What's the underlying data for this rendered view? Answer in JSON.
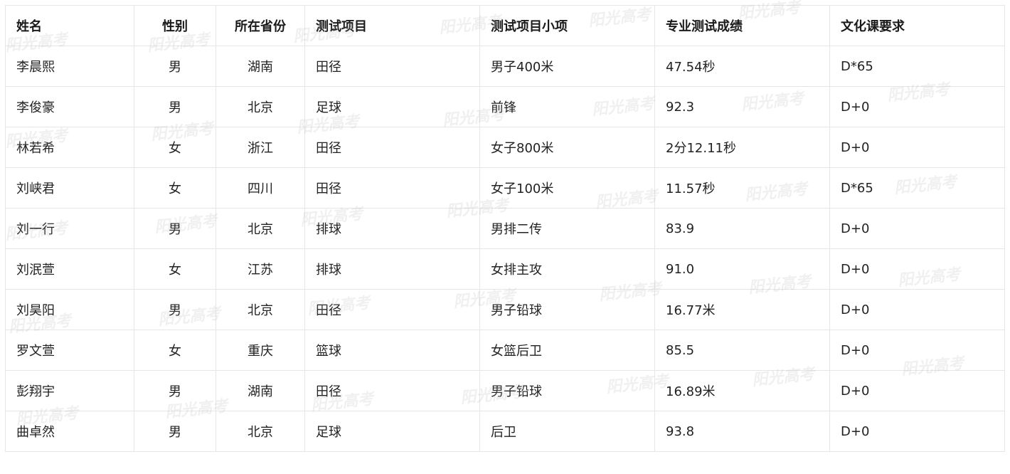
{
  "table": {
    "headers": [
      "姓名",
      "性别",
      "所在省份",
      "测试项目",
      "测试项目小项",
      "专业测试成绩",
      "文化课要求"
    ],
    "rows": [
      [
        "李晨熙",
        "男",
        "湖南",
        "田径",
        "男子400米",
        "47.54秒",
        "D*65"
      ],
      [
        "李俊豪",
        "男",
        "北京",
        "足球",
        "前锋",
        "92.3",
        "D+0"
      ],
      [
        "林若希",
        "女",
        "浙江",
        "田径",
        "女子800米",
        "2分12.11秒",
        "D+0"
      ],
      [
        "刘峡君",
        "女",
        "四川",
        "田径",
        "女子100米",
        "11.57秒",
        "D*65"
      ],
      [
        "刘一行",
        "男",
        "北京",
        "排球",
        "男排二传",
        "83.9",
        "D+0"
      ],
      [
        "刘泯萱",
        "女",
        "江苏",
        "排球",
        "女排主攻",
        "91.0",
        "D+0"
      ],
      [
        "刘昊阳",
        "男",
        "北京",
        "田径",
        "男子铅球",
        "16.77米",
        "D+0"
      ],
      [
        "罗文萱",
        "女",
        "重庆",
        "篮球",
        "女篮后卫",
        "85.5",
        "D+0"
      ],
      [
        "彭翔宇",
        "男",
        "湖南",
        "田径",
        "男子铅球",
        "16.89米",
        "D+0"
      ],
      [
        "曲卓然",
        "男",
        "北京",
        "足球",
        "后卫",
        "93.8",
        "D+0"
      ]
    ]
  },
  "watermark": {
    "text": "阳光高考"
  }
}
